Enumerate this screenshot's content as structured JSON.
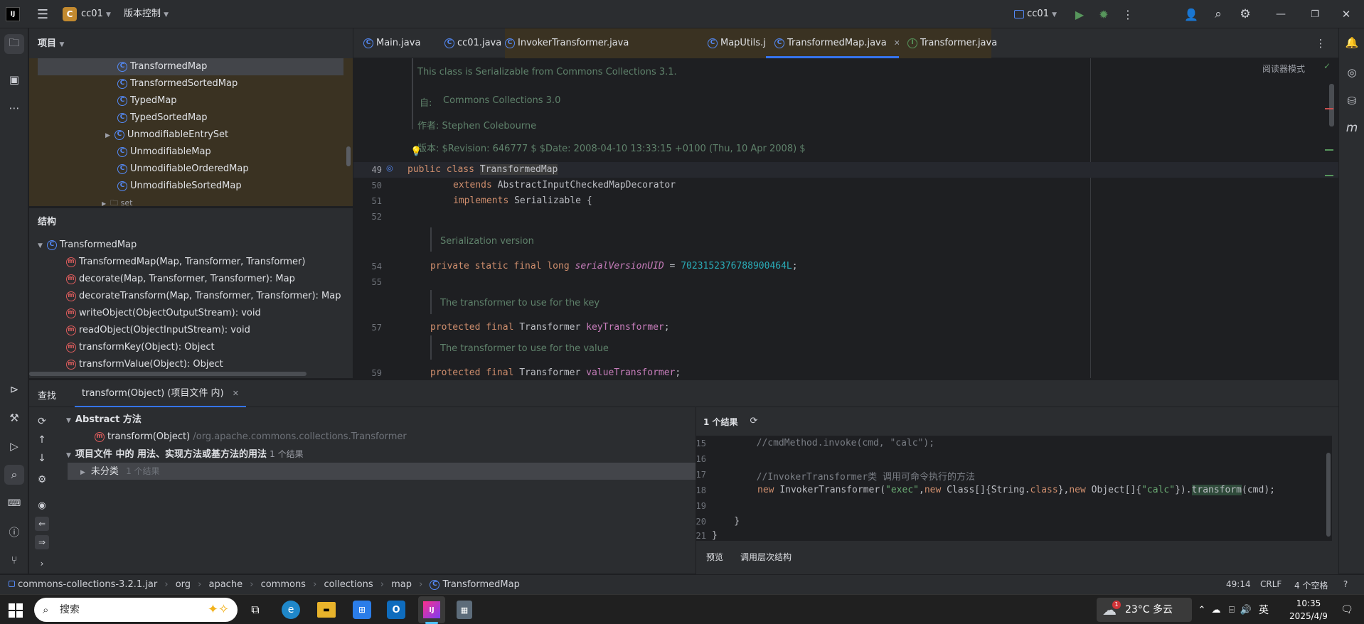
{
  "titlebar": {
    "project_badge": "C",
    "project_name": "cc01",
    "vcs_label": "版本控制",
    "run_config": "cc01"
  },
  "project_panel": {
    "title": "项目",
    "items": [
      {
        "label": "TransformedMap",
        "selected": true
      },
      {
        "label": "TransformedSortedMap"
      },
      {
        "label": "TypedMap"
      },
      {
        "label": "TypedSortedMap"
      },
      {
        "label": "UnmodifiableEntrySet",
        "expandable": true
      },
      {
        "label": "UnmodifiableMap"
      },
      {
        "label": "UnmodifiableOrderedMap"
      },
      {
        "label": "UnmodifiableSortedMap"
      },
      {
        "label": "set"
      }
    ]
  },
  "structure_panel": {
    "title": "结构",
    "root": "TransformedMap",
    "members": [
      {
        "label": "TransformedMap(Map, Transformer, Transformer)",
        "icon": "protected"
      },
      {
        "label": "decorate(Map, Transformer, Transformer): Map",
        "icon": "public-static"
      },
      {
        "label": "decorateTransform(Map, Transformer, Transformer): Map",
        "icon": "public-static"
      },
      {
        "label": "writeObject(ObjectOutputStream): void",
        "icon": "private"
      },
      {
        "label": "readObject(ObjectInputStream): void",
        "icon": "private"
      },
      {
        "label": "transformKey(Object): Object",
        "icon": "protected"
      },
      {
        "label": "transformValue(Object): Object",
        "icon": "protected"
      }
    ]
  },
  "editor_tabs": [
    {
      "label": "Main.java"
    },
    {
      "label": "cc01.java"
    },
    {
      "label": "InvokerTransformer.java"
    },
    {
      "label": "MapUtils.java"
    },
    {
      "label": "TransformedMap.java",
      "active": true
    },
    {
      "label": "Transformer.java"
    }
  ],
  "editor": {
    "reader_mode": "阅读器模式",
    "doc_serializable": "This class is Serializable from Commons Collections 3.1.",
    "doc_since_label": "自:",
    "doc_since_value": "Commons Collections 3.0",
    "doc_author": "作者: Stephen Colebourne",
    "doc_version": "版本: $Revision: 646777 $ $Date: 2008-04-10 13:33:15 +0100 (Thu, 10 Apr 2008) $",
    "doc_serial": "Serialization version",
    "doc_key": "The transformer to use for the key",
    "doc_value": "The transformer to use for the value",
    "line_numbers": [
      "49",
      "50",
      "51",
      "52",
      "54",
      "55",
      "57",
      "59"
    ],
    "l49_kw": "public class ",
    "l49_name": "TransformedMap",
    "l50_kw": "extends ",
    "l50_rest": "AbstractInputCheckedMapDecorator",
    "l51_kw": "implements ",
    "l51_rest": "Serializable {",
    "l54_kw": "private static final long ",
    "l54_field": "serialVersionUID",
    "l54_eq": " = ",
    "l54_num": "7023152376788900464L",
    "l54_end": ";",
    "l57_kw": "protected final ",
    "l57_type": "Transformer ",
    "l57_field": "keyTransformer",
    "l57_end": ";",
    "l59_kw": "protected final ",
    "l59_type": "Transformer ",
    "l59_field": "valueTransformer",
    "l59_end": ";"
  },
  "find_panel": {
    "title": "查找",
    "tab_label": "transform(Object) (项目文件 内)",
    "group1": "Abstract 方法",
    "group1_item": "transform(Object)",
    "group1_item_path": "/org.apache.commons.collections.Transformer",
    "group2": "项目文件 中的 用法、实现方法或基方法的用法",
    "group2_count": "1 个结果",
    "group2_child": "未分类",
    "group2_child_count": "1 个结果",
    "results_count": "1 个结果",
    "preview_lines": [
      {
        "n": "15",
        "code": "        //cmdMethod.invoke(cmd, \"calc\");"
      },
      {
        "n": "16",
        "code": ""
      },
      {
        "n": "17",
        "code": "        //InvokerTransformer类 调用可命令执行的方法"
      },
      {
        "n": "18",
        "code": ""
      },
      {
        "n": "19",
        "code": ""
      },
      {
        "n": "20",
        "code": "    }"
      },
      {
        "n": "21",
        "code": "}"
      }
    ],
    "l18_new": "new ",
    "l18_a": "InvokerTransformer(",
    "l18_s1": "\"exec\"",
    "l18_b": ",",
    "l18_new2": "new ",
    "l18_c": "Class[]{String.",
    "l18_cls": "class",
    "l18_d": "},",
    "l18_new3": "new ",
    "l18_e": "Object[]{",
    "l18_s2": "\"calc\"",
    "l18_f": "}).",
    "l18_tr": "transform",
    "l18_g": "(cmd);",
    "bottom_tabs": [
      "预览",
      "调用层次结构"
    ]
  },
  "statusbar": {
    "breadcrumb": [
      "commons-collections-3.2.1.jar",
      "org",
      "apache",
      "commons",
      "collections",
      "map",
      "TransformedMap"
    ],
    "position": "49:14",
    "line_sep": "CRLF",
    "indent": "4 个空格"
  },
  "taskbar": {
    "search_placeholder": "搜索",
    "weather_temp": "23°C",
    "weather_desc": "多云",
    "ime": "英",
    "time": "10:35",
    "date": "2025/4/9",
    "weather_badge": "1"
  }
}
